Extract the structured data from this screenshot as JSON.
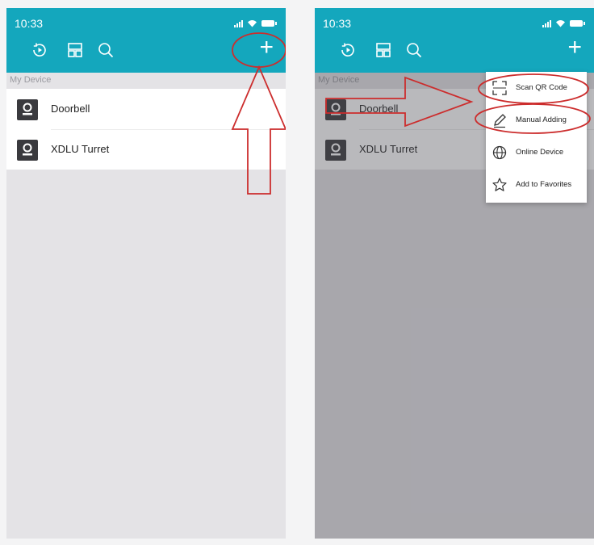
{
  "colors": {
    "accent": "#14a7bd",
    "annotation": "#cc2d2d"
  },
  "status_bar": {
    "time": "10:33"
  },
  "toolbar": {
    "icons": [
      "playback-icon",
      "layout-icon",
      "search-icon"
    ],
    "add_label": "+"
  },
  "device_list": {
    "section_title": "My Device",
    "items": [
      {
        "label": "Doorbell",
        "icon": "camera-icon"
      },
      {
        "label": "XDLU Turret",
        "icon": "camera-icon"
      }
    ]
  },
  "add_menu": {
    "items": [
      {
        "label": "Scan QR Code",
        "icon": "scan-icon"
      },
      {
        "label": "Manual Adding",
        "icon": "pencil-icon"
      },
      {
        "label": "Online Device",
        "icon": "globe-icon"
      },
      {
        "label": "Add to Favorites",
        "icon": "star-icon"
      }
    ]
  }
}
